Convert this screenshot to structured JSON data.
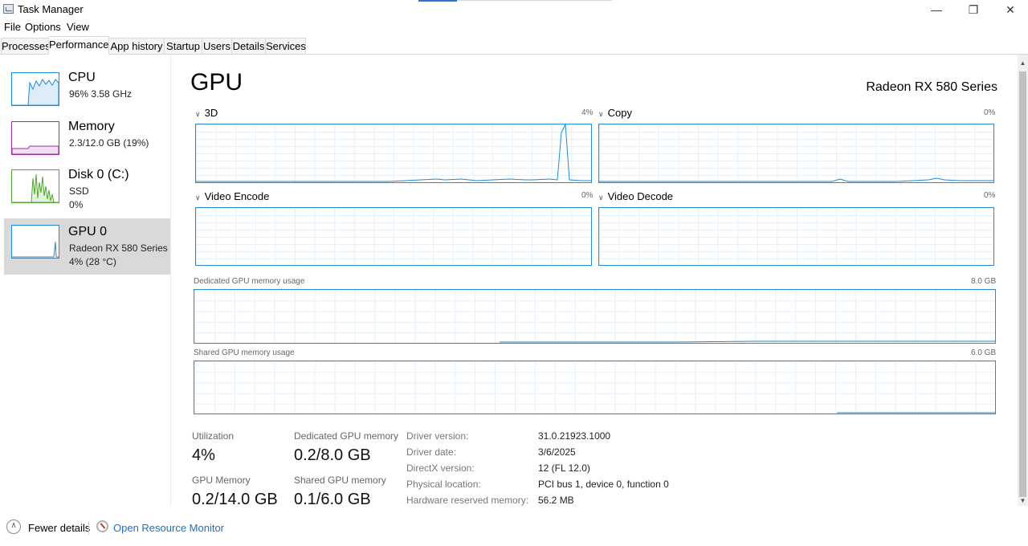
{
  "window": {
    "title": "Task Manager",
    "minimize": "—",
    "restore": "❐",
    "close": "✕"
  },
  "menu": [
    "File",
    "Options",
    "View"
  ],
  "tabs": [
    "Processes",
    "Performance",
    "App history",
    "Startup",
    "Users",
    "Details",
    "Services"
  ],
  "active_tab": "Performance",
  "sidebar": {
    "items": [
      {
        "title": "CPU",
        "line1": "96%  3.58 GHz",
        "line2": "",
        "color": "#1f8ad6"
      },
      {
        "title": "Memory",
        "line1": "2.3/12.0 GB (19%)",
        "line2": "",
        "color": "#9e2ba7"
      },
      {
        "title": "Disk 0 (C:)",
        "line1": "SSD",
        "line2": "0%",
        "color": "#4ea72e"
      },
      {
        "title": "GPU 0",
        "line1": "Radeon RX 580 Series",
        "line2": "4%  (28 °C)",
        "color": "#1f8ad6"
      }
    ],
    "active_index": 3
  },
  "main": {
    "title": "GPU",
    "gpu_name": "Radeon RX 580 Series",
    "engines": [
      {
        "name": "3D",
        "percent": "4%"
      },
      {
        "name": "Copy",
        "percent": "0%"
      },
      {
        "name": "Video Encode",
        "percent": "0%"
      },
      {
        "name": "Video Decode",
        "percent": "0%"
      }
    ],
    "dedicated_label": "Dedicated GPU memory usage",
    "dedicated_max": "8.0 GB",
    "shared_label": "Shared GPU memory usage",
    "shared_max": "6.0 GB"
  },
  "stats": {
    "utilization_label": "Utilization",
    "utilization_value": "4%",
    "dedicated_mem_label": "Dedicated GPU memory",
    "dedicated_mem_value": "0.2/8.0 GB",
    "gpu_memory_label": "GPU Memory",
    "gpu_memory_value": "0.2/14.0 GB",
    "shared_mem_label": "Shared GPU memory",
    "shared_mem_value": "0.1/6.0 GB"
  },
  "info": [
    {
      "label": "Driver version:",
      "value": "31.0.21923.1000"
    },
    {
      "label": "Driver date:",
      "value": "3/6/2025"
    },
    {
      "label": "DirectX version:",
      "value": "12 (FL 12.0)"
    },
    {
      "label": "Physical location:",
      "value": "PCI bus 1, device 0, function 0"
    },
    {
      "label": "Hardware reserved memory:",
      "value": "56.2 MB"
    }
  ],
  "footer": {
    "fewer_details": "Fewer details",
    "open_resource_monitor": "Open Resource Monitor"
  },
  "icons": [
    "task-manager-icon",
    "chevron-up-icon",
    "resource-monitor-icon",
    "chevron-down-icon"
  ]
}
